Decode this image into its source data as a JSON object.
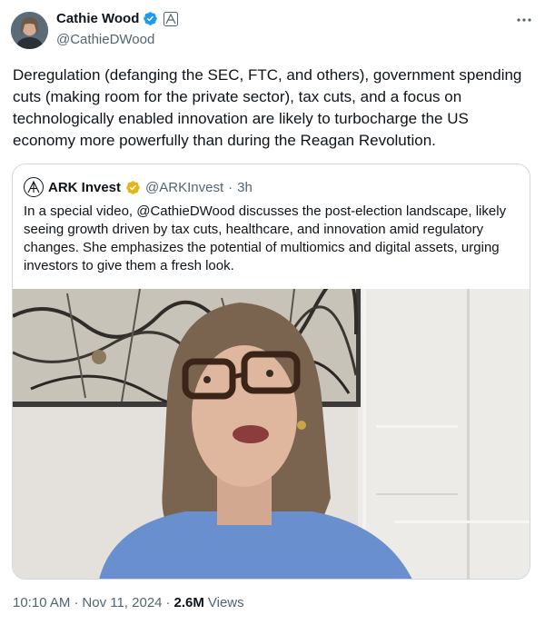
{
  "author": {
    "display_name": "Cathie Wood",
    "handle": "@CathieDWood",
    "verified_icon": "verified-badge-icon",
    "affiliate_icon": "ark-affiliate-icon"
  },
  "tweet": {
    "text": "Deregulation (defanging the SEC, FTC, and others), government spending cuts (making room for the private sector), tax cuts, and a focus on technologically enabled innovation are likely to turbocharge the US economy more powerfully than during the Reagan Revolution."
  },
  "quote": {
    "display_name": "ARK Invest",
    "handle": "@ARKInvest",
    "separator": "·",
    "time": "3h",
    "text": "In a special video, @CathieDWood discusses the post-election landscape, likely seeing growth driven by tax cuts, healthcare, and innovation amid regulatory changes. She emphasizes the potential of multiomics and digital assets, urging investors to give them a fresh look."
  },
  "footer": {
    "time": "10:10 AM",
    "separator1": "·",
    "date": "Nov 11, 2024",
    "separator2": "·",
    "views_count": "2.6M",
    "views_label": "Views"
  },
  "colors": {
    "text": "#0f1419",
    "secondary": "#536471",
    "verified_blue": "#1d9bf0",
    "org_gold": "#e2b719",
    "border": "#cfd9de"
  }
}
